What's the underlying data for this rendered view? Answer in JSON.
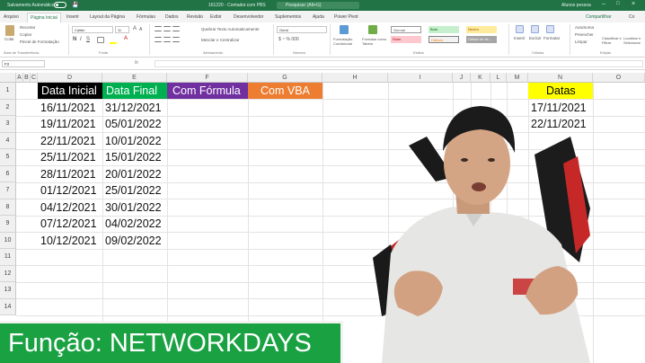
{
  "titlebar": {
    "autosave": "Salvamento Automático",
    "doc_left": "161220 - Contador.com PBS",
    "search": "Pesquisar (Alt+G)",
    "user": "Alunos pessoa"
  },
  "tabs": [
    "Arquivo",
    "Página Inicial",
    "Inserir",
    "Layout da Página",
    "Fórmulas",
    "Dados",
    "Revisão",
    "Exibir",
    "Desenvolvedor",
    "Suplementos",
    "Ajuda",
    "Power Pivot"
  ],
  "tabs_right": {
    "share": "Compartilhar",
    "comments": "Co"
  },
  "ribbon": {
    "clipboard": {
      "paste": "Colar",
      "cut": "Recortar",
      "copy": "Copiar",
      "format_painter": "Pincel de Formatação",
      "label": "Área de Transferência"
    },
    "font": {
      "name": "Calibri",
      "size": "11",
      "label": "Fonte"
    },
    "alignment": {
      "wrap": "Quebrar Texto Automaticamente",
      "merge": "Mesclar e Centralizar",
      "label": "Alinhamento"
    },
    "number": {
      "format": "Geral",
      "label": "Número"
    },
    "styles": {
      "conditional": "Formatação Condicional",
      "table": "Formatar como Tabela",
      "normal": "Normal",
      "bom": "Bom",
      "neutro": "Neutro",
      "ruim": "Ruim",
      "calculo": "Cálculo",
      "celula": "Célula de Ve...",
      "label": "Estilos"
    },
    "cells": {
      "insert": "Inserir",
      "delete": "Excluir",
      "format": "Formatar",
      "label": "Células"
    },
    "editing": {
      "autosum": "AutoSoma",
      "fill": "Preencher",
      "clear": "Limpar",
      "sort": "Classificar e Filtrar",
      "find": "Localizar e Selecionar",
      "label": "Edição"
    }
  },
  "formula_bar": {
    "name_box": "F2",
    "fx": "fx",
    "content": ""
  },
  "sheet": {
    "columns": [
      "A",
      "B",
      "C",
      "D",
      "E",
      "F",
      "G",
      "H",
      "I",
      "J",
      "K",
      "L",
      "M",
      "N",
      "O"
    ],
    "rows": [
      "1",
      "2",
      "3",
      "4",
      "5",
      "6",
      "7",
      "8",
      "9",
      "10",
      "11",
      "12",
      "13",
      "14"
    ],
    "headers": {
      "D": {
        "text": "Data Inicial",
        "color": "#000000"
      },
      "E": {
        "text": "Data Final",
        "color": "#00b050"
      },
      "F": {
        "text": "Com Fórmula",
        "color": "#7030a0"
      },
      "G": {
        "text": "Com VBA",
        "color": "#ed7d31"
      },
      "N": {
        "text": "Datas",
        "color": "#ffff00"
      }
    },
    "start_dates": [
      "16/11/2021",
      "19/11/2021",
      "22/11/2021",
      "25/11/2021",
      "28/11/2021",
      "01/12/2021",
      "04/12/2021",
      "07/12/2021",
      "10/12/2021"
    ],
    "end_dates": [
      "31/12/2021",
      "05/01/2022",
      "10/01/2022",
      "15/01/2022",
      "20/01/2022",
      "25/01/2022",
      "30/01/2022",
      "04/02/2022",
      "09/02/2022"
    ],
    "holidays": [
      "17/11/2021",
      "22/11/2021"
    ]
  },
  "banner": {
    "text": "Função: NETWORKDAYS"
  }
}
